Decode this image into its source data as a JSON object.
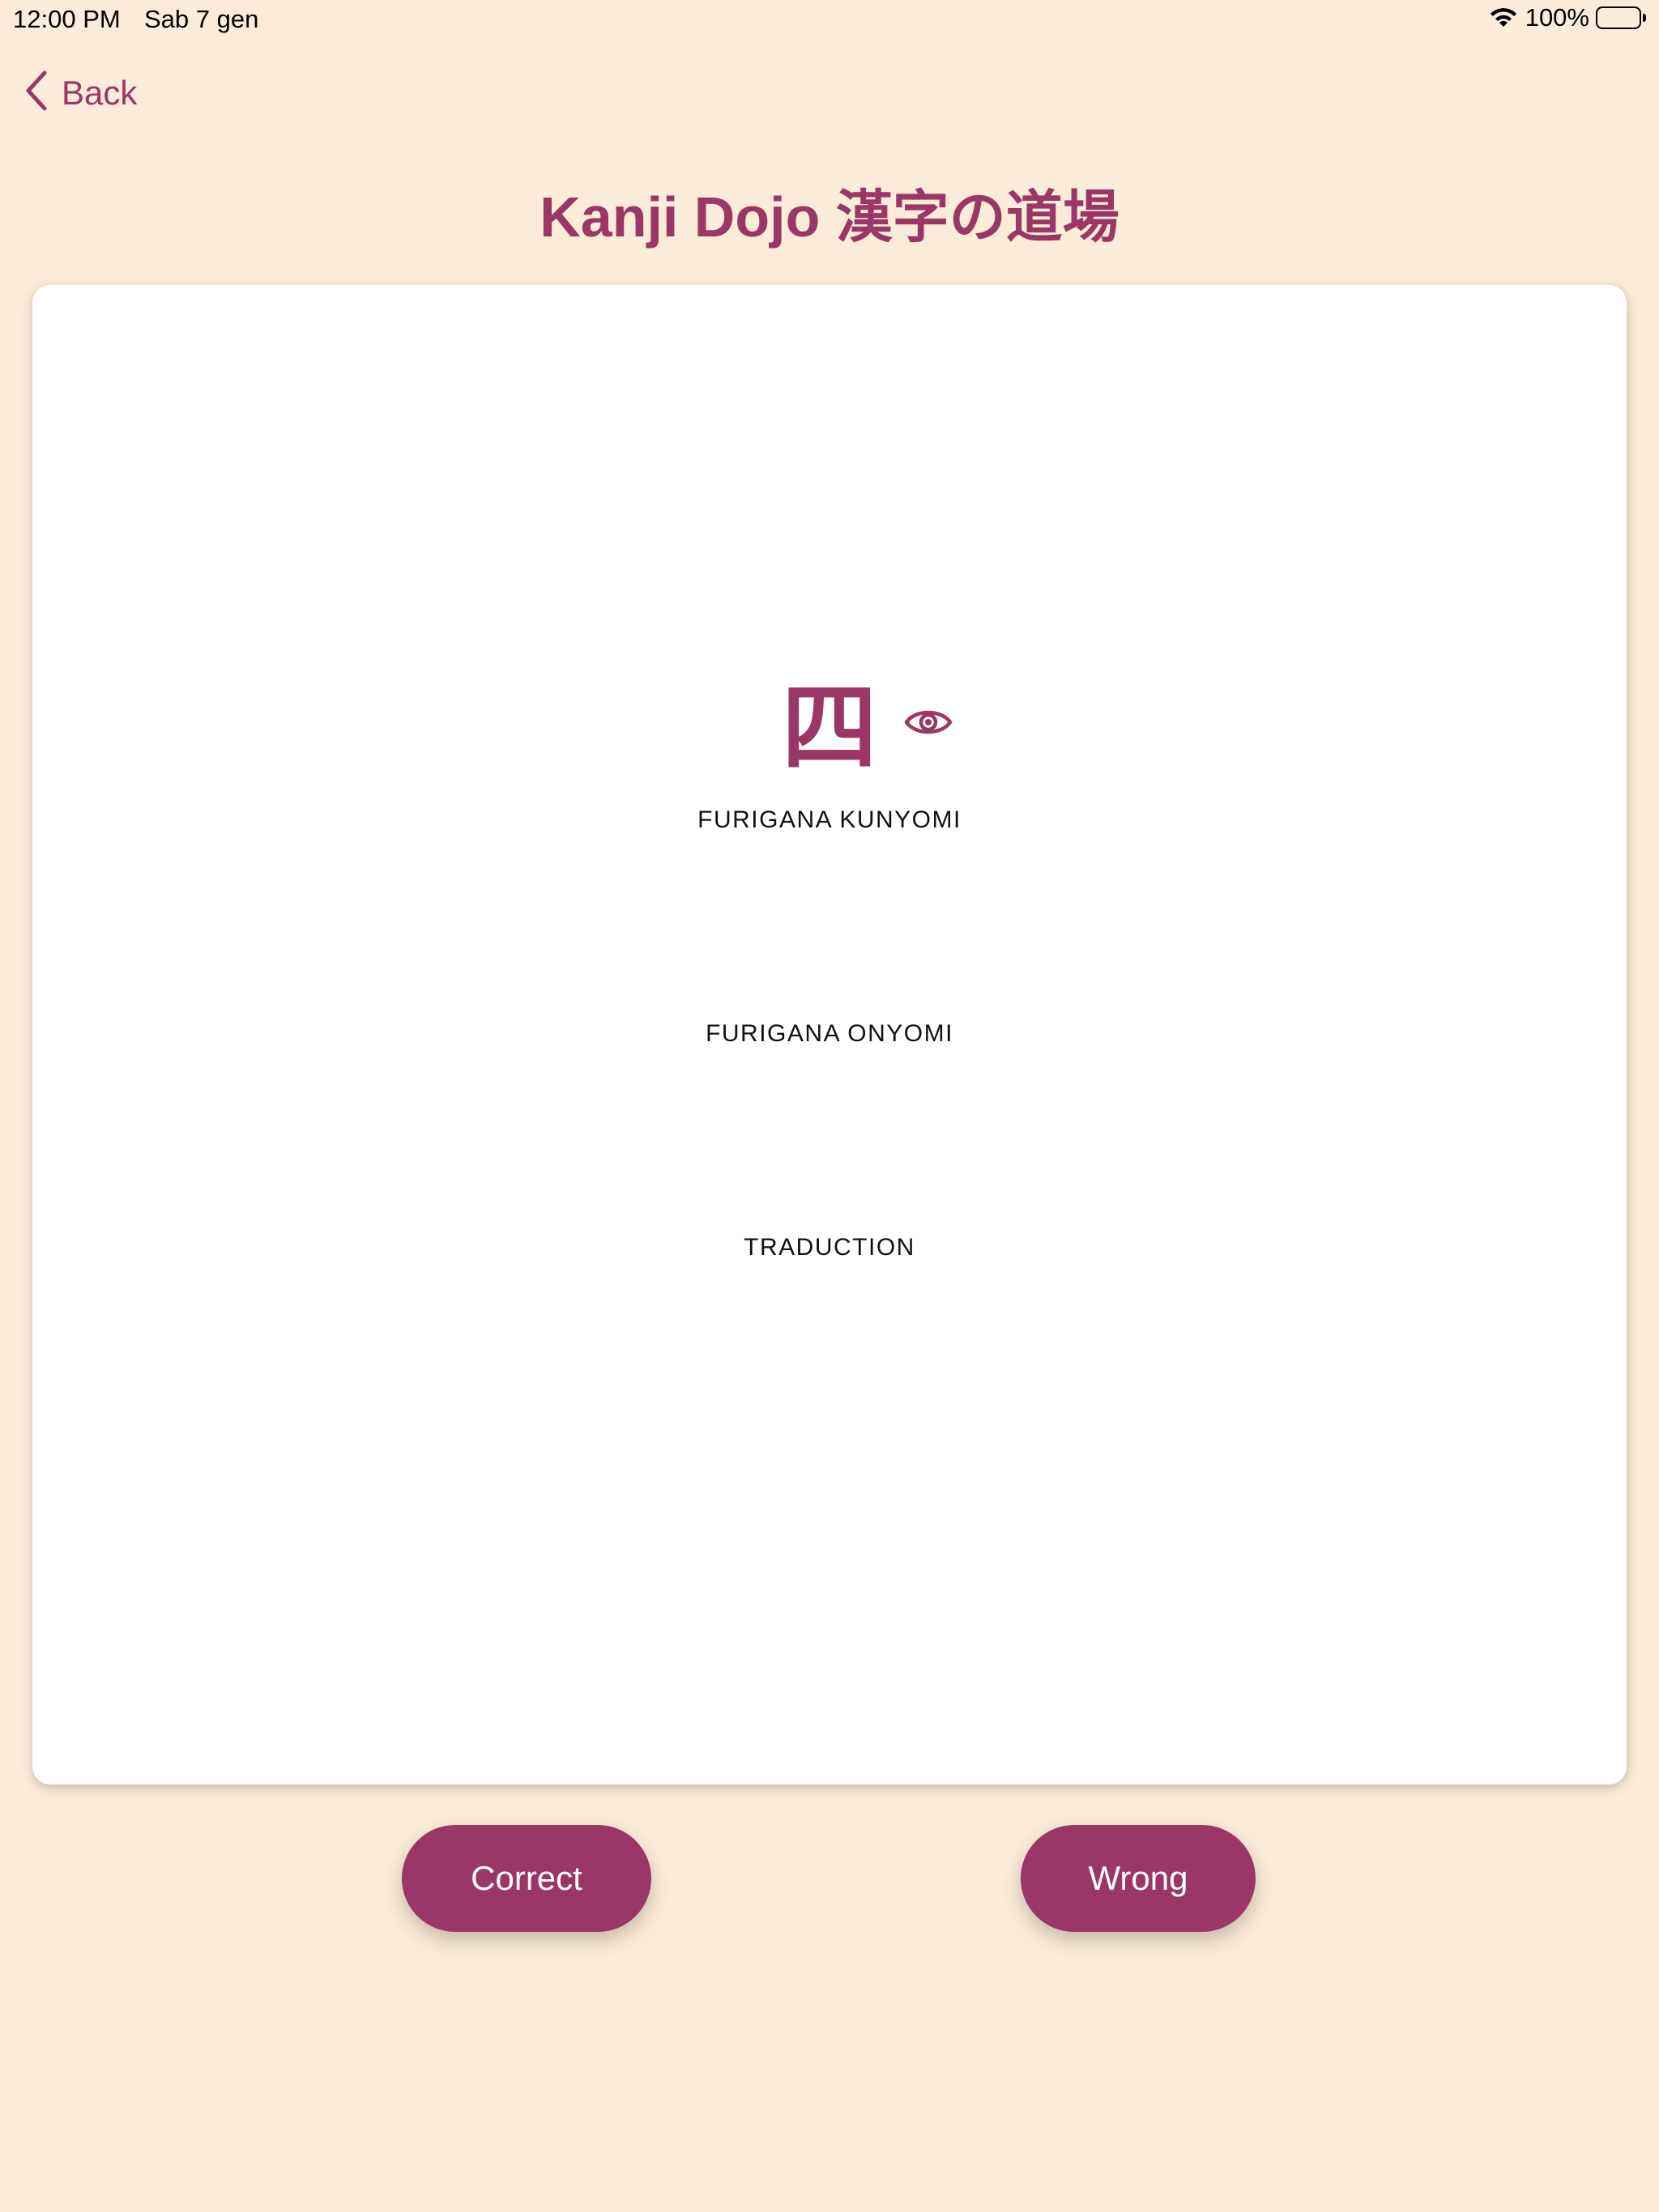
{
  "status_bar": {
    "time": "12:00 PM",
    "date": "Sab 7 gen",
    "battery_text": "100%",
    "battery_level": 1.0,
    "wifi_icon": "wifi-icon",
    "battery_icon": "battery-icon"
  },
  "nav": {
    "back_label": "Back",
    "back_icon": "chevron-left-icon"
  },
  "page": {
    "title": "Kanji Dojo 漢字の道場"
  },
  "card": {
    "kanji": "四",
    "reveal_icon": "eye-icon",
    "labels": {
      "kunyomi": "FURIGANA KUNYOMI",
      "onyomi": "FURIGANA ONYOMI",
      "traduction": "TRADUCTION"
    }
  },
  "actions": {
    "correct_label": "Correct",
    "wrong_label": "Wrong"
  },
  "colors": {
    "accent": "#9a3766",
    "background": "#fbecd9",
    "card": "#ffffff"
  }
}
